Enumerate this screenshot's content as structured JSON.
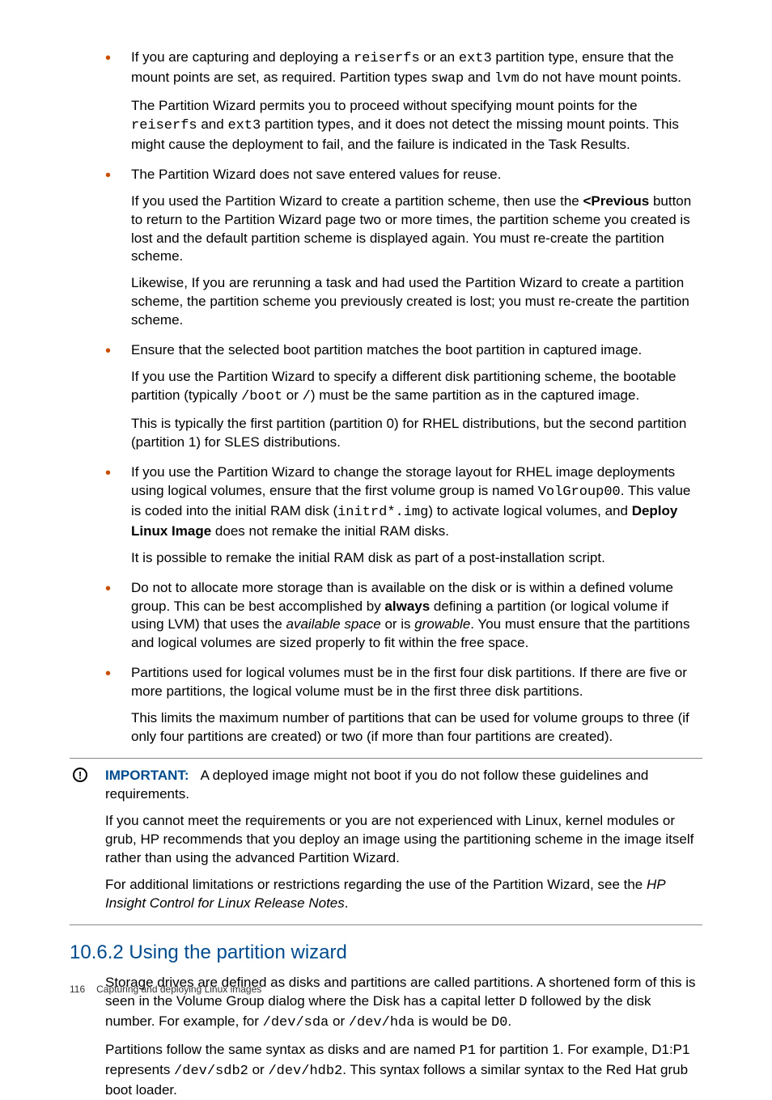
{
  "bullets": [
    {
      "p1a": "If you are capturing and deploying a ",
      "p1b": "reiserfs",
      "p1c": " or an ",
      "p1d": "ext3",
      "p1e": " partition type, ensure that the mount points are set, as required. Partition types ",
      "p1f": "swap",
      "p1g": " and ",
      "p1h": "lvm",
      "p1i": " do not have mount points.",
      "p2a": "The Partition Wizard permits you to proceed without specifying mount points for the ",
      "p2b": "reiserfs",
      "p2c": " and ",
      "p2d": "ext3",
      "p2e": " partition types, and it does not detect the missing mount points. This might cause the deployment to fail, and the failure is indicated in the Task Results."
    },
    {
      "p1": "The Partition Wizard does not save entered values for reuse.",
      "p2a": "If you used the Partition Wizard to create a partition scheme, then use the ",
      "p2b": "<Previous",
      "p2c": " button to return to the Partition Wizard page two or more times, the partition scheme you created is lost and the default partition scheme is displayed again. You must re-create the partition scheme.",
      "p3": "Likewise, If you are rerunning a task and had used the Partition Wizard to create a partition scheme, the partition scheme you previously created is lost; you must re-create the partition scheme."
    },
    {
      "p1": "Ensure that the selected boot partition matches the boot partition in captured image.",
      "p2a": "If you use the Partition Wizard to specify a different disk partitioning scheme, the bootable partition (typically ",
      "p2b": "/boot",
      "p2c": " or ",
      "p2d": "/",
      "p2e": ") must be the same partition as in the captured image.",
      "p3": "This is typically the first partition (partition 0) for RHEL distributions, but the second partition (partition 1) for SLES distributions."
    },
    {
      "p1a": "If you use the Partition Wizard to change the storage layout for RHEL image deployments using logical volumes, ensure that the first volume group is named ",
      "p1b": "VolGroup00",
      "p1c": ". This value is coded into the initial RAM disk (",
      "p1d": "initrd*.img",
      "p1e": ") to activate logical volumes, and ",
      "p1f": "Deploy Linux Image",
      "p1g": " does not remake the initial RAM disks.",
      "p2": "It is possible to remake the initial RAM disk as part of a post-installation script."
    },
    {
      "p1a": "Do not to allocate more storage than is available on the disk or is within a defined volume group. This can be best accomplished by ",
      "p1b": "always",
      "p1c": " defining a partition (or logical volume if using LVM) that uses the ",
      "p1d": "available space",
      "p1e": " or is ",
      "p1f": "growable",
      "p1g": ". You must ensure that the partitions and logical volumes are sized properly to fit within the free space."
    },
    {
      "p1": "Partitions used for logical volumes must be in the first four disk partitions. If there are five or more partitions, the logical volume must be in the first three disk partitions.",
      "p2": "This limits the maximum number of partitions that can be used for volume groups to three (if only four partitions are created) or two (if more than four partitions are created)."
    }
  ],
  "important": {
    "label": "IMPORTANT:",
    "p1": "A deployed image might not boot if you do not follow these guidelines and requirements.",
    "p2": "If you cannot meet the requirements or you are not experienced with Linux, kernel modules or grub, HP recommends that you deploy an image using the partitioning scheme in the image itself rather than using the advanced Partition Wizard.",
    "p3a": "For additional limitations or restrictions regarding the use of the Partition Wizard, see the ",
    "p3b": "HP Insight Control for Linux Release Notes",
    "p3c": "."
  },
  "section": {
    "num": "10.6.2",
    "title": "Using the partition wizard",
    "p1a": "Storage drives are defined as disks and partitions are called partitions. A shortened form of this is seen in the Volume Group dialog where the Disk has a capital letter ",
    "p1b": "D",
    "p1c": " followed by the disk number. For example, for ",
    "p1d": "/dev/sda",
    "p1e": " or ",
    "p1f": "/dev/hda",
    "p1g": " is would be ",
    "p1h": "D0",
    "p1i": ".",
    "p2a": "Partitions follow the same syntax as disks and are named ",
    "p2b": "P1",
    "p2c": " for partition 1. For example, D1:P1 represents ",
    "p2d": "/dev/sdb2",
    "p2e": " or ",
    "p2f": "/dev/hdb2",
    "p2g": ". This syntax follows a similar syntax to the Red Hat grub boot loader."
  },
  "footer": {
    "page": "116",
    "chapter": "Capturing and deploying Linux images"
  }
}
